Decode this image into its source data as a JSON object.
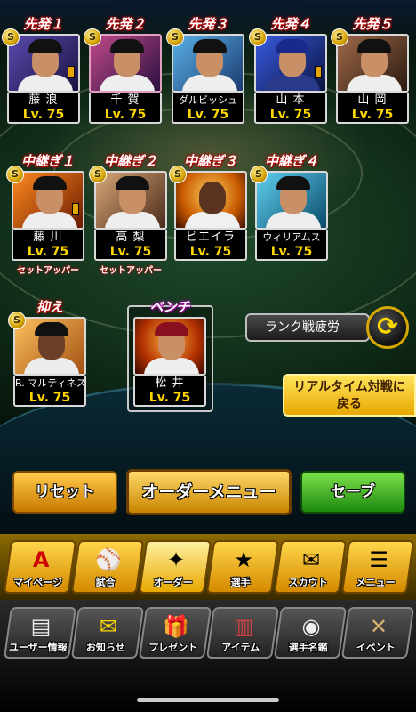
{
  "starters": [
    {
      "slot": "先発１",
      "name": "藤 浪",
      "level": "Lv. 75",
      "bg": "#3a2f6e"
    },
    {
      "slot": "先発２",
      "name": "千 賀",
      "level": "Lv. 75",
      "bg": "#6b2a4a"
    },
    {
      "slot": "先発３",
      "name": "ダルビッシュ",
      "level": "Lv. 75",
      "bg": "#2a5a8a"
    },
    {
      "slot": "先発４",
      "name": "山 本",
      "level": "Lv. 75",
      "bg": "#1c2f6e"
    },
    {
      "slot": "先発５",
      "name": "山 岡",
      "level": "Lv. 75",
      "bg": "#5a3a2a"
    }
  ],
  "relievers": [
    {
      "slot": "中継ぎ１",
      "name": "藤 川",
      "level": "Lv. 75",
      "sub": "セットアッパー",
      "bg": "#b84a10"
    },
    {
      "slot": "中継ぎ２",
      "name": "高 梨",
      "level": "Lv. 75",
      "sub": "セットアッパー",
      "bg": "#8a5a3a"
    },
    {
      "slot": "中継ぎ３",
      "name": "ビエイラ",
      "level": "Lv. 75",
      "bg": "#c86a10"
    },
    {
      "slot": "中継ぎ４",
      "name": "ウィリアムス",
      "level": "Lv. 75",
      "bg": "#2a8aa8"
    }
  ],
  "closer": {
    "slot": "抑え",
    "name": "R. マルティネス",
    "level": "Lv. 75",
    "bg": "#d88a30"
  },
  "bench": {
    "slot": "ベンチ",
    "name": "松 井",
    "level": "Lv. 75",
    "bg": "#c85a10"
  },
  "fatigue_label": "ランク戦疲労",
  "realtime_label_1": "リアルタイム対戦に",
  "realtime_label_2": "戻る",
  "actions": {
    "reset": "リセット",
    "order_menu": "オーダーメニュー",
    "save": "セーブ"
  },
  "menu": [
    {
      "label": "マイページ",
      "icon": "A"
    },
    {
      "label": "試合",
      "icon": "⚾"
    },
    {
      "label": "オーダー",
      "icon": "✦"
    },
    {
      "label": "選手",
      "icon": "★"
    },
    {
      "label": "スカウト",
      "icon": "✉"
    },
    {
      "label": "メニュー",
      "icon": "☰"
    }
  ],
  "bottom": [
    {
      "label": "ユーザー情報",
      "icon": "▤"
    },
    {
      "label": "お知らせ",
      "icon": "✉"
    },
    {
      "label": "プレゼント",
      "icon": "🎁"
    },
    {
      "label": "アイテム",
      "icon": "▥"
    },
    {
      "label": "選手名鑑",
      "icon": "◉"
    },
    {
      "label": "イベント",
      "icon": "✕"
    }
  ],
  "badge_text": "S"
}
